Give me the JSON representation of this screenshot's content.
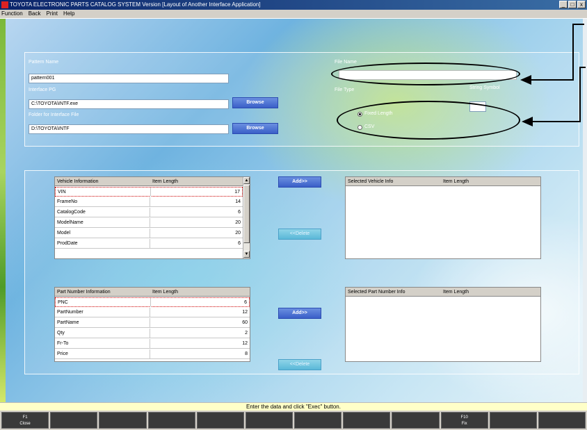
{
  "window": {
    "title": "TOYOTA ELECTRONIC PARTS CATALOG SYSTEM Version [Layout of Another Interface Application]",
    "controls": [
      "_",
      "□",
      "x"
    ]
  },
  "menu": [
    "Function",
    "Back",
    "Print",
    "Help"
  ],
  "form": {
    "pattern_name_label": "Pattern Name",
    "pattern_name_value": "pattern001",
    "interface_pg_label": "Interface PG",
    "interface_pg_value": "C:\\TOYOTA\\INTF.exe",
    "folder_label": "Folder for Interface File",
    "folder_value": "D:\\TOYOTA\\INTF",
    "browse_label": "Browse",
    "file_name_label": "File Name",
    "file_name_value": "",
    "file_type_label": "File Type",
    "string_symbol_label": "String Symbol",
    "string_symbol_value": "",
    "radio_fixed_label": "Fixed Length",
    "radio_csv_label": "CSV",
    "file_type_selected": "Fixed Length"
  },
  "vehicle_table": {
    "col1": "Vehicle Information",
    "col2": "Item Length",
    "rows": [
      {
        "name": "VIN",
        "length": "17"
      },
      {
        "name": "FrameNo",
        "length": "14"
      },
      {
        "name": "CatalogCode",
        "length": "6"
      },
      {
        "name": "ModelName",
        "length": "20"
      },
      {
        "name": "Model",
        "length": "20"
      },
      {
        "name": "ProdDate",
        "length": "6"
      }
    ]
  },
  "selected_vehicle_table": {
    "col1": "Selected Vehicle Info",
    "col2": "Item Length"
  },
  "part_table": {
    "col1": "Part Number Information",
    "col2": "Item Length",
    "rows": [
      {
        "name": "PNC",
        "length": "6"
      },
      {
        "name": "PartNumber",
        "length": "12"
      },
      {
        "name": "PartName",
        "length": "60"
      },
      {
        "name": "Qty",
        "length": "2"
      },
      {
        "name": "Fr-To",
        "length": "12"
      },
      {
        "name": "Price",
        "length": "8"
      }
    ]
  },
  "selected_part_table": {
    "col1": "Selected Part Number Info",
    "col2": "Item Length"
  },
  "buttons": {
    "add": "Add>>",
    "delete": "<<Delete"
  },
  "status": "Enter the data and click \"Exec\" button.",
  "fkeys": [
    {
      "key": "F1",
      "label": "Close"
    },
    {
      "key": "",
      "label": ""
    },
    {
      "key": "",
      "label": ""
    },
    {
      "key": "",
      "label": ""
    },
    {
      "key": "",
      "label": ""
    },
    {
      "key": "",
      "label": ""
    },
    {
      "key": "",
      "label": ""
    },
    {
      "key": "",
      "label": ""
    },
    {
      "key": "",
      "label": ""
    },
    {
      "key": "F10",
      "label": "Fix"
    },
    {
      "key": "",
      "label": ""
    },
    {
      "key": "",
      "label": ""
    }
  ]
}
